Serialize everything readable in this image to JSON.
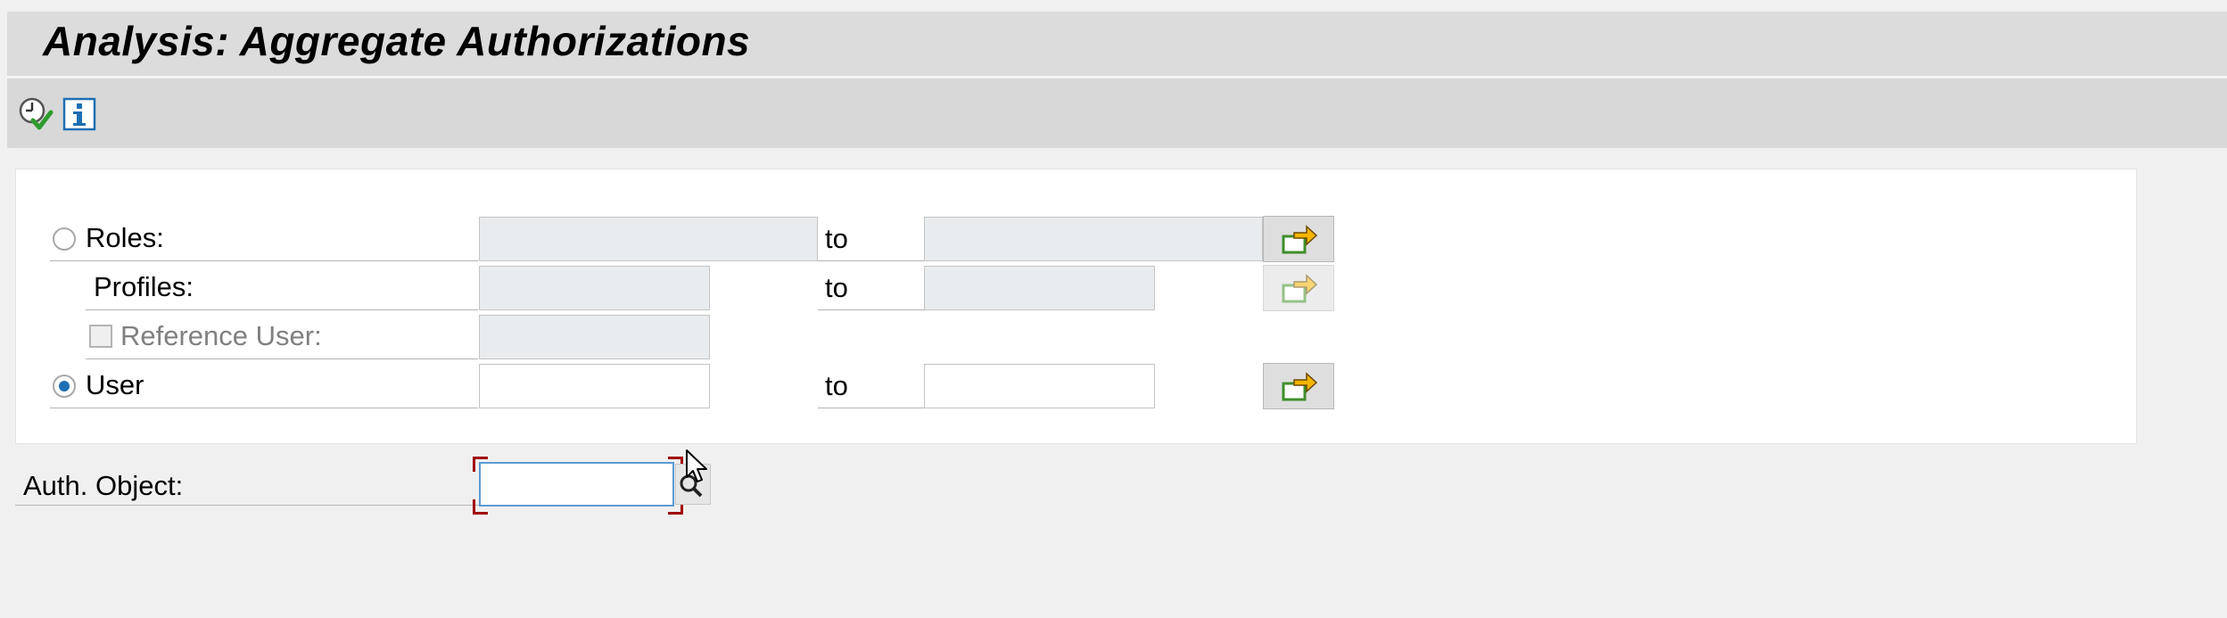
{
  "window": {
    "title": "Analysis: Aggregate Authorizations"
  },
  "toolbar": {
    "buttons": [
      {
        "name": "execute-button",
        "icon": "clock-check-icon"
      },
      {
        "name": "info-button",
        "icon": "info-icon"
      }
    ]
  },
  "selection": {
    "roles": {
      "label": "Roles:",
      "from_value": "",
      "to_label": "to",
      "to_value": "",
      "selected": false
    },
    "profiles": {
      "label": "Profiles:",
      "from_value": "",
      "to_label": "to",
      "to_value": ""
    },
    "reference_user": {
      "label": "Reference User:",
      "checked": false,
      "value": ""
    },
    "user": {
      "label": "User",
      "from_value": "",
      "to_label": "to",
      "to_value": "",
      "selected": true
    }
  },
  "auth_object": {
    "label": "Auth. Object:",
    "value": ""
  },
  "colors": {
    "accent": "#1f6fb3",
    "field_disabled": "#e9ecee",
    "multi_arrow": "#f4b400",
    "multi_box": "#3f8f2a"
  }
}
